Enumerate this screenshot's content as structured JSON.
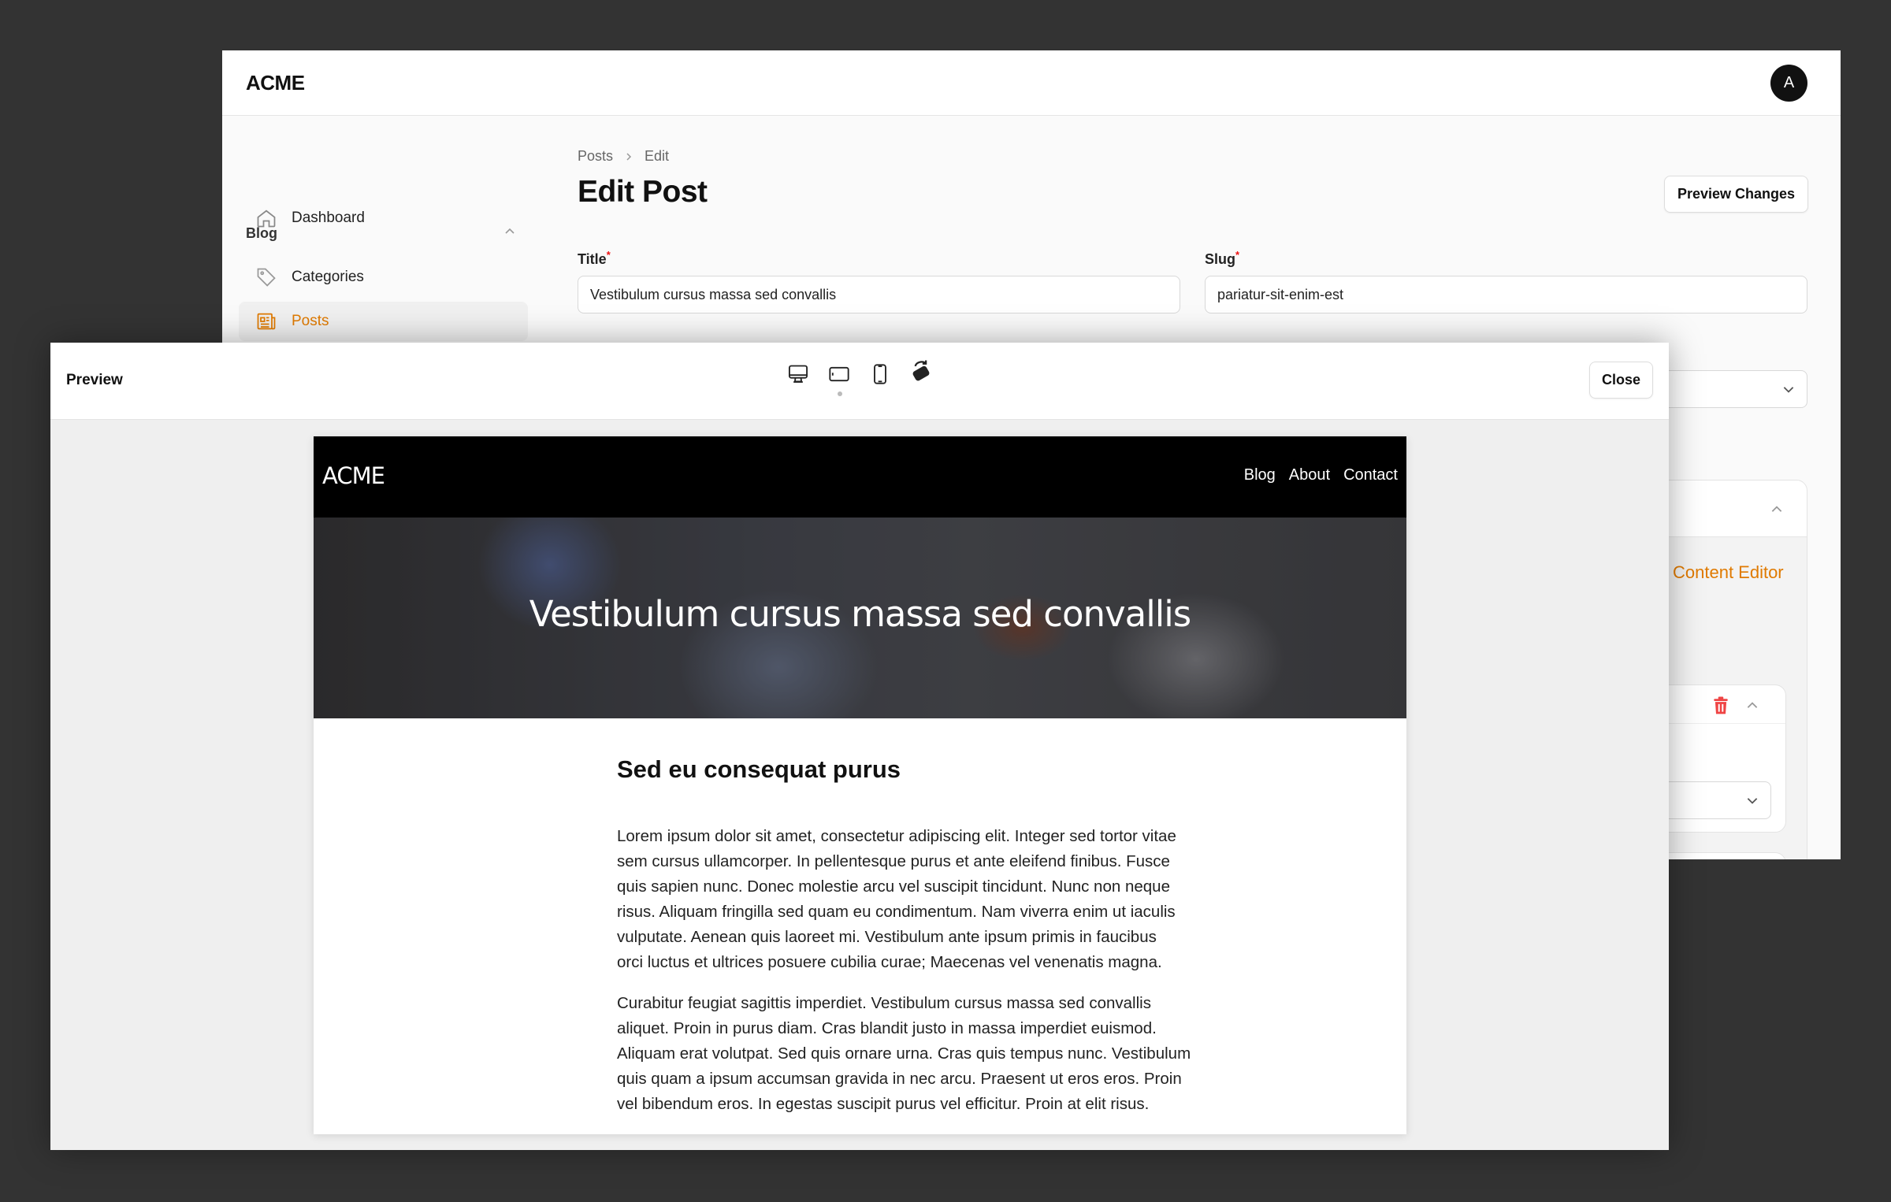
{
  "app": {
    "logo": "ACME",
    "avatar_initial": "A"
  },
  "sidebar": {
    "dashboard": "Dashboard",
    "group": "Blog",
    "items": [
      {
        "label": "Categories"
      },
      {
        "label": "Posts",
        "active": true
      }
    ]
  },
  "breadcrumb": [
    "Posts",
    "Edit"
  ],
  "page_title": "Edit Post",
  "preview_changes": "Preview Changes",
  "form": {
    "title_label": "Title",
    "title_value": "Vestibulum cursus massa sed convallis",
    "slug_label": "Slug",
    "slug_value": "pariatur-sit-enim-est",
    "content_editor": "Content Editor"
  },
  "colors": {
    "accent": "#e07a00",
    "danger": "#ef4444"
  },
  "modal": {
    "title": "Preview",
    "close": "Close",
    "devices": [
      "desktop-icon",
      "tablet-landscape-icon",
      "mobile-icon",
      "rotate-icon"
    ]
  },
  "site": {
    "logo": "ACME",
    "nav": [
      "Blog",
      "About",
      "Contact"
    ],
    "hero_title": "Vestibulum cursus massa sed convallis",
    "heading": "Sed eu consequat purus",
    "paragraphs": [
      [
        "Lorem ipsum dolor sit amet, consectetur adipiscing elit. Integer sed tortor vitae",
        "sem cursus ullamcorper. In pellentesque purus et ante eleifend finibus. Fusce",
        "quis sapien nunc. Donec molestie arcu vel suscipit tincidunt. Nunc non neque",
        "risus. Aliquam fringilla sed quam eu condimentum. Nam viverra enim ut iaculis",
        "vulputate. Aenean quis laoreet mi. Vestibulum ante ipsum primis in faucibus",
        "orci luctus et ultrices posuere cubilia curae; Maecenas vel venenatis magna."
      ],
      [
        "Curabitur feugiat sagittis imperdiet. Vestibulum cursus massa sed convallis",
        "aliquet. Proin in purus diam. Cras blandit justo in massa imperdiet euismod.",
        "Aliquam erat volutpat. Sed quis ornare urna. Cras quis tempus nunc. Vestibulum",
        "quis quam a ipsum accumsan gravida in nec arcu. Praesent ut eros eros. Proin",
        "vel bibendum eros. In egestas suscipit purus vel efficitur. Proin at elit risus."
      ]
    ]
  }
}
